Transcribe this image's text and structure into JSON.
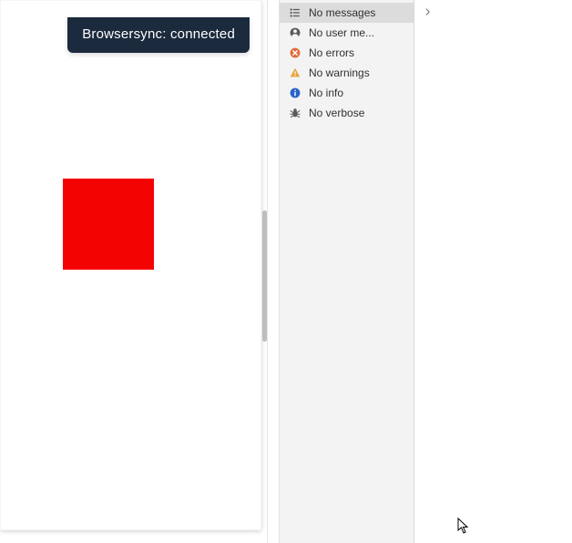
{
  "preview": {
    "notification_text": "Browsersync: connected",
    "red_square_color": "#f40303"
  },
  "devtools_sidebar": {
    "items": [
      {
        "icon": "list-icon",
        "label": "No messages",
        "selected": true
      },
      {
        "icon": "user-icon",
        "label": "No user me...",
        "selected": false
      },
      {
        "icon": "error-icon",
        "label": "No errors",
        "selected": false
      },
      {
        "icon": "warning-icon",
        "label": "No warnings",
        "selected": false
      },
      {
        "icon": "info-icon",
        "label": "No info",
        "selected": false
      },
      {
        "icon": "bug-icon",
        "label": "No verbose",
        "selected": false
      }
    ]
  },
  "colors": {
    "error": "#e06c3d",
    "warning": "#e8a33d",
    "info": "#2962c9",
    "neutral": "#5a5a5a"
  }
}
